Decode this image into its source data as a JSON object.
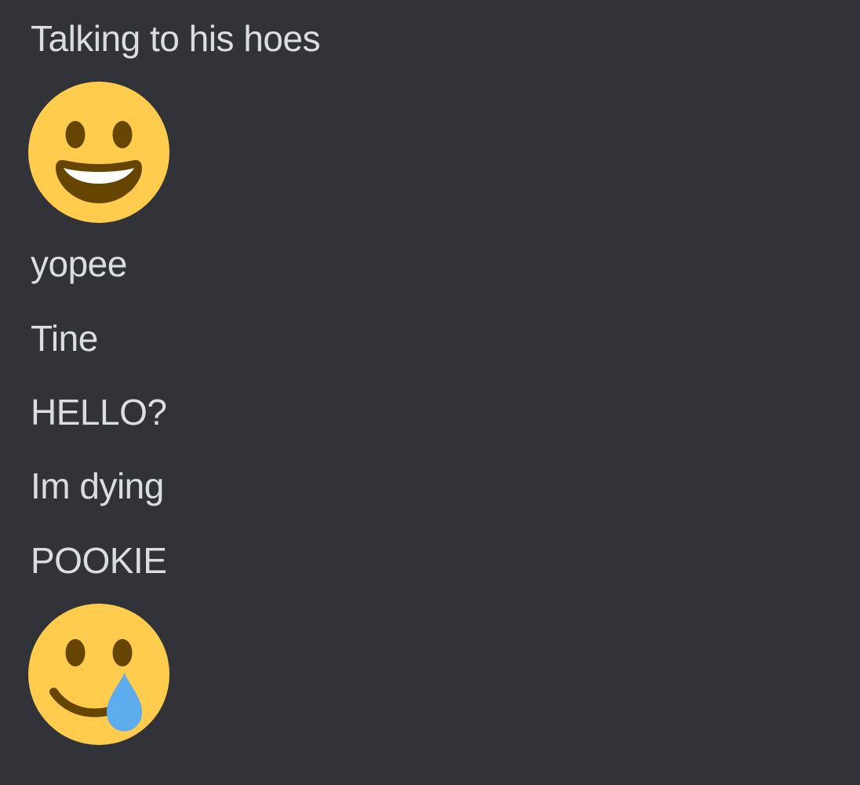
{
  "messages": [
    {
      "type": "text",
      "text": "Talking to his hoes"
    },
    {
      "type": "emoji",
      "icon": "grinning-face-icon"
    },
    {
      "type": "text",
      "text": "yopee"
    },
    {
      "type": "text",
      "text": "Tine"
    },
    {
      "type": "text",
      "text": "HELLO?"
    },
    {
      "type": "text",
      "text": "Im dying"
    },
    {
      "type": "text",
      "text": "POOKIE"
    },
    {
      "type": "emoji",
      "icon": "smiling-face-with-tear-icon"
    }
  ],
  "colors": {
    "background": "#313338",
    "text": "#dbdee1",
    "emoji_face": "#FFCC4D",
    "emoji_features": "#664500",
    "tear": "#5DADEC"
  }
}
